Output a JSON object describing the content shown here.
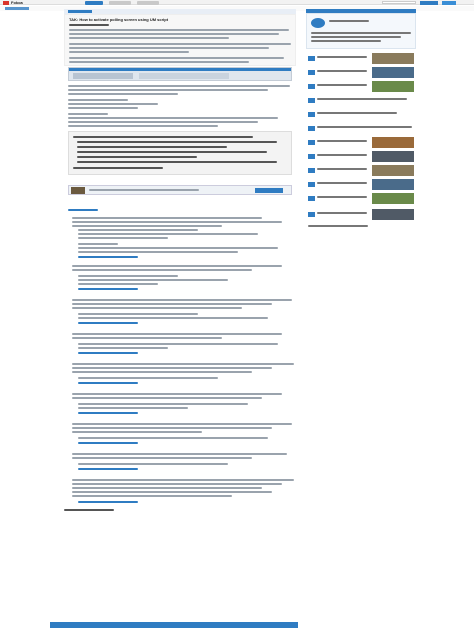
{
  "header": {
    "brand": "Fokoa",
    "nav_items": [
      "",
      "",
      ""
    ],
    "search_placeholder": "",
    "action_buttons": [
      "",
      ""
    ]
  },
  "article": {
    "title": "TAK: How to activate polling screen using UM script"
  },
  "sidebar": {
    "author_avatar_label": "",
    "related": [
      "",
      "",
      "",
      "",
      "",
      "",
      "",
      "",
      "",
      "",
      "",
      ""
    ]
  },
  "footer": {
    "text": ""
  },
  "colors": {
    "accent": "#2f7cc2",
    "brand_red": "#d9342b"
  }
}
